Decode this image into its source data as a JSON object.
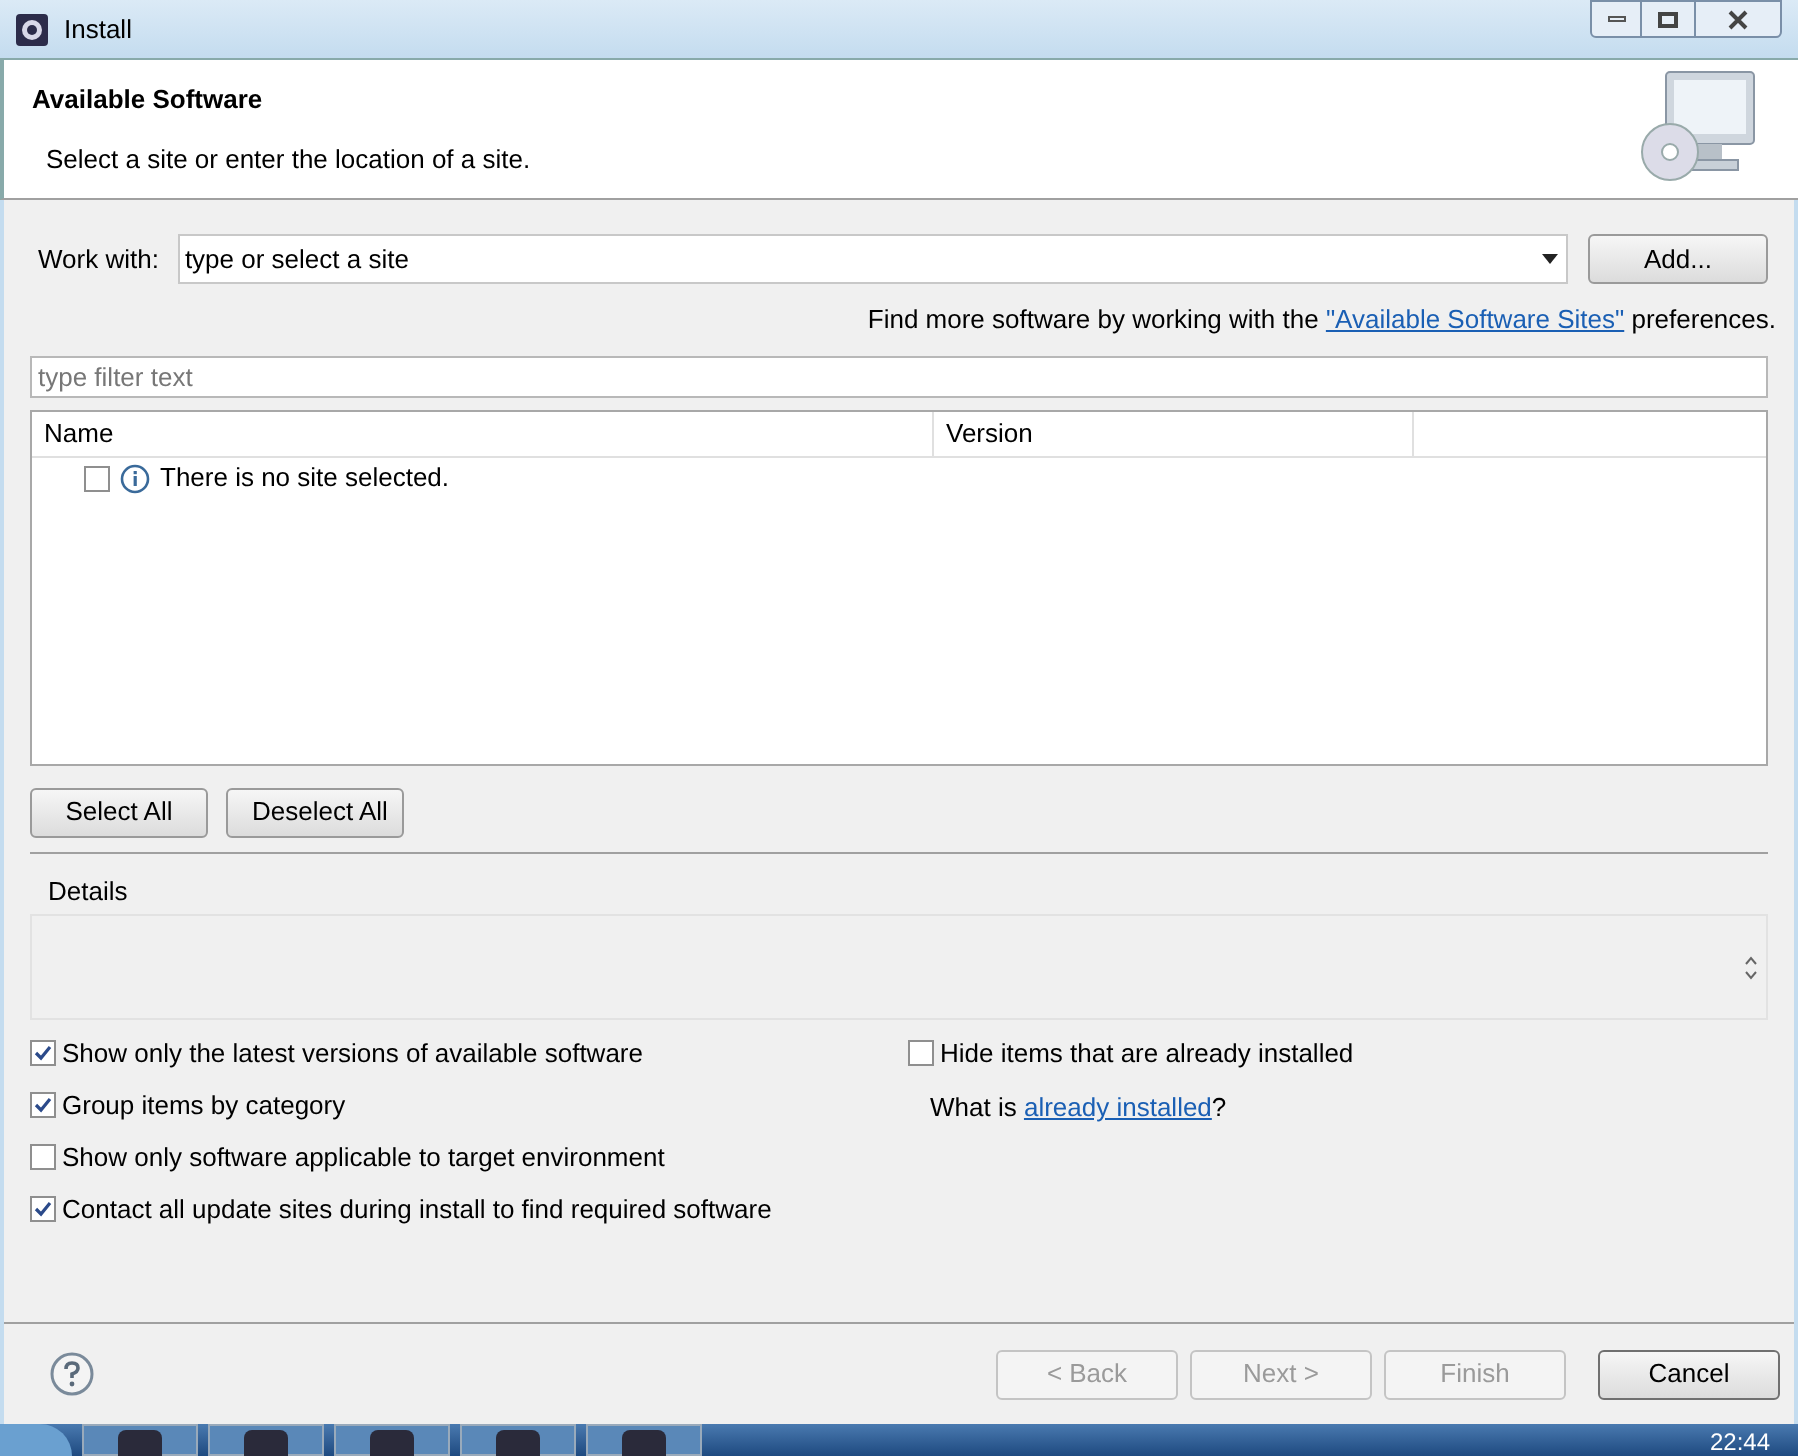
{
  "window": {
    "title": "Install"
  },
  "header": {
    "title": "Available Software",
    "subtitle": "Select a site or enter the location of a site."
  },
  "work_with": {
    "label": "Work with:",
    "placeholder": "type or select a site",
    "add_button": "Add..."
  },
  "find_more": {
    "before": "Find more software by working with the ",
    "link": "\"Available Software Sites\"",
    "after": " preferences."
  },
  "filter": {
    "placeholder": "type filter text"
  },
  "table": {
    "columns": [
      "Name",
      "Version"
    ],
    "rows": [
      {
        "name": "There is no site selected.",
        "checked": false
      }
    ]
  },
  "select_buttons": [
    "Select All",
    "Deselect All"
  ],
  "details": {
    "label": "Details"
  },
  "options_left": [
    {
      "label": "Show only the latest versions of available software",
      "checked": true
    },
    {
      "label": "Group items by category",
      "checked": true
    },
    {
      "label": "Show only software applicable to target environment",
      "checked": false
    },
    {
      "label": "Contact all update sites during install to find required software",
      "checked": true
    }
  ],
  "options_right": {
    "checkbox": {
      "label": "Hide items that are already installed",
      "checked": false
    },
    "what_is": {
      "before": "What is ",
      "link": "already installed",
      "after": "?"
    }
  },
  "footer_buttons": [
    {
      "label": "< Back",
      "disabled": true
    },
    {
      "label": "Next >",
      "disabled": true
    },
    {
      "label": "Finish",
      "disabled": true
    },
    {
      "label": "Cancel",
      "disabled": false
    }
  ],
  "taskbar": {
    "clock": "22:44"
  }
}
